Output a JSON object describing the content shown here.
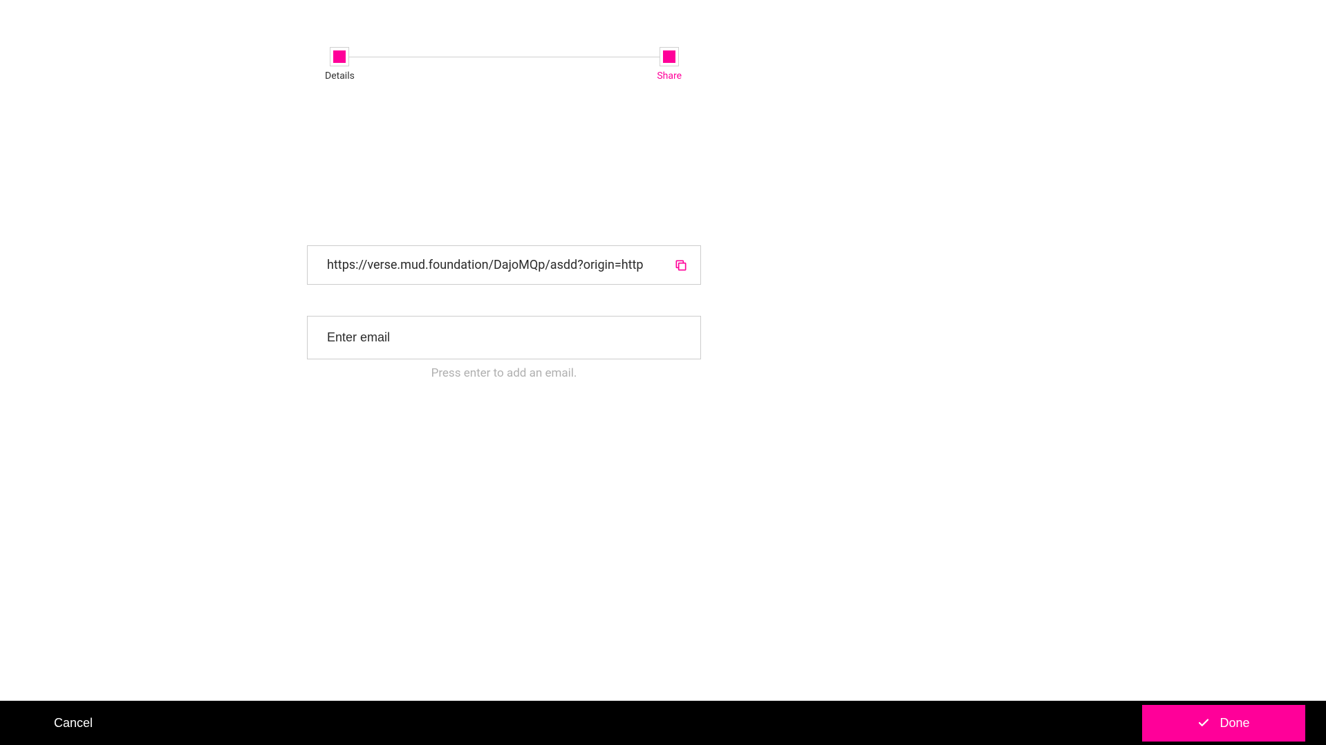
{
  "stepper": {
    "steps": [
      {
        "label": "Details",
        "active": false
      },
      {
        "label": "Share",
        "active": true
      }
    ]
  },
  "share": {
    "url": "https://verse.mud.foundation/DajoMQp/asdd?origin=http",
    "email_placeholder": "Enter email",
    "email_hint": "Press enter to add an email."
  },
  "footer": {
    "cancel_label": "Cancel",
    "done_label": "Done"
  },
  "colors": {
    "accent": "#ff0099"
  }
}
